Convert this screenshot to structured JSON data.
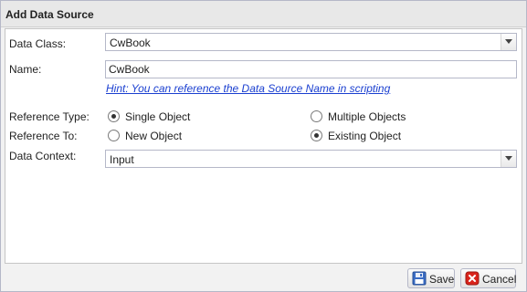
{
  "dialog": {
    "title": "Add Data Source"
  },
  "form": {
    "data_class": {
      "label": "Data Class:",
      "value": "CwBook"
    },
    "name": {
      "label": "Name:",
      "value": "CwBook"
    },
    "hint": "Hint: You can reference the Data Source Name in scripting",
    "reference_type": {
      "label": "Reference Type:",
      "options": [
        {
          "label": "Single Object",
          "selected": true
        },
        {
          "label": "Multiple Objects",
          "selected": false
        }
      ]
    },
    "reference_to": {
      "label": "Reference To:",
      "options": [
        {
          "label": "New Object",
          "selected": false
        },
        {
          "label": "Existing Object",
          "selected": true
        }
      ]
    },
    "data_context": {
      "label": "Data Context:",
      "value": "Input"
    }
  },
  "footer": {
    "save_label": "Save",
    "cancel_label": "Cancel"
  },
  "colors": {
    "hint_link": "#1a3fd0",
    "cancel_red": "#d9241c",
    "save_blue": "#3a6cc4"
  }
}
